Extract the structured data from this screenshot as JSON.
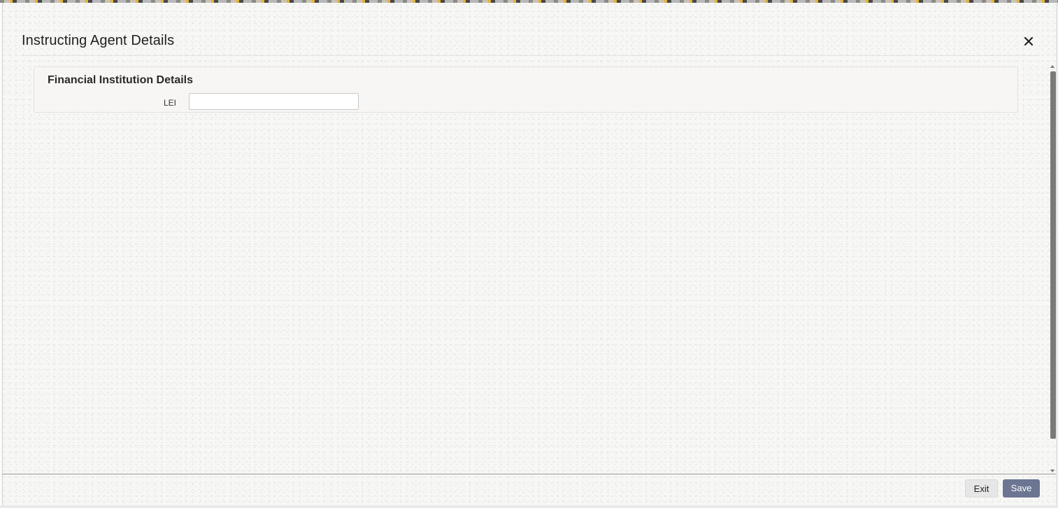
{
  "dialog": {
    "title": "Instructing Agent Details",
    "close_icon": "close-icon"
  },
  "panel": {
    "title": "Financial Institution Details",
    "fields": [
      {
        "label": "LEI",
        "value": "",
        "placeholder": ""
      }
    ]
  },
  "footer": {
    "exit_label": "Exit",
    "save_label": "Save"
  },
  "colors": {
    "save_button": "#6c7592",
    "exit_button": "#e6e6e6",
    "scrollbar_thumb": "#7a7a7a"
  }
}
